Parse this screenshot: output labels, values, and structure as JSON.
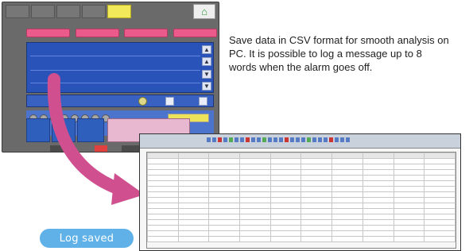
{
  "caption": {
    "text": "Save data in CSV format for smooth analysis on PC. It is possible to log a message up to 8 words when the alarm goes off."
  },
  "badge": {
    "label": "Log saved"
  },
  "icons": {
    "home": "home-icon",
    "arrow": "curved-arrow-icon"
  },
  "colors": {
    "arrow": "#d04f8f",
    "badge": "#5fb1e8",
    "screen": "#2a53b9"
  }
}
